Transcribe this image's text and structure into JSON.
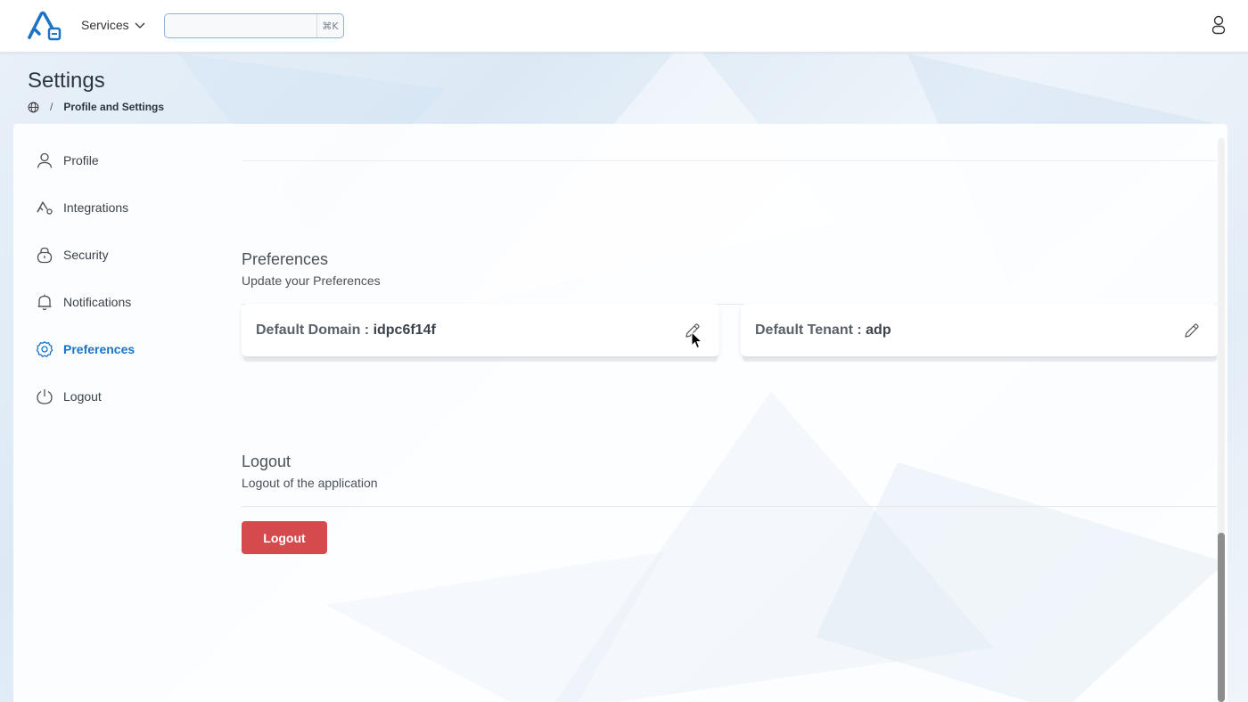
{
  "topbar": {
    "services_label": "Services",
    "search_placeholder": "",
    "search_shortcut": "⌘K"
  },
  "header": {
    "title": "Settings",
    "breadcrumb_separator": "/",
    "breadcrumb_current": "Profile and Settings"
  },
  "sidebar": {
    "items": [
      {
        "label": "Profile",
        "icon": "user-icon"
      },
      {
        "label": "Integrations",
        "icon": "integrations-icon"
      },
      {
        "label": "Security",
        "icon": "lock-icon"
      },
      {
        "label": "Notifications",
        "icon": "bell-icon"
      },
      {
        "label": "Preferences",
        "icon": "gear-icon",
        "active": true
      },
      {
        "label": "Logout",
        "icon": "power-icon"
      }
    ]
  },
  "preferences": {
    "title": "Preferences",
    "subtitle": "Update your Preferences",
    "domain_label": "Default Domain : ",
    "domain_value": "idpc6f14f",
    "tenant_label": "Default Tenant : ",
    "tenant_value": "adp"
  },
  "logout_section": {
    "title": "Logout",
    "subtitle": "Logout of the application",
    "button_label": "Logout"
  },
  "colors": {
    "accent": "#1a73c7",
    "danger": "#d54a4d"
  }
}
